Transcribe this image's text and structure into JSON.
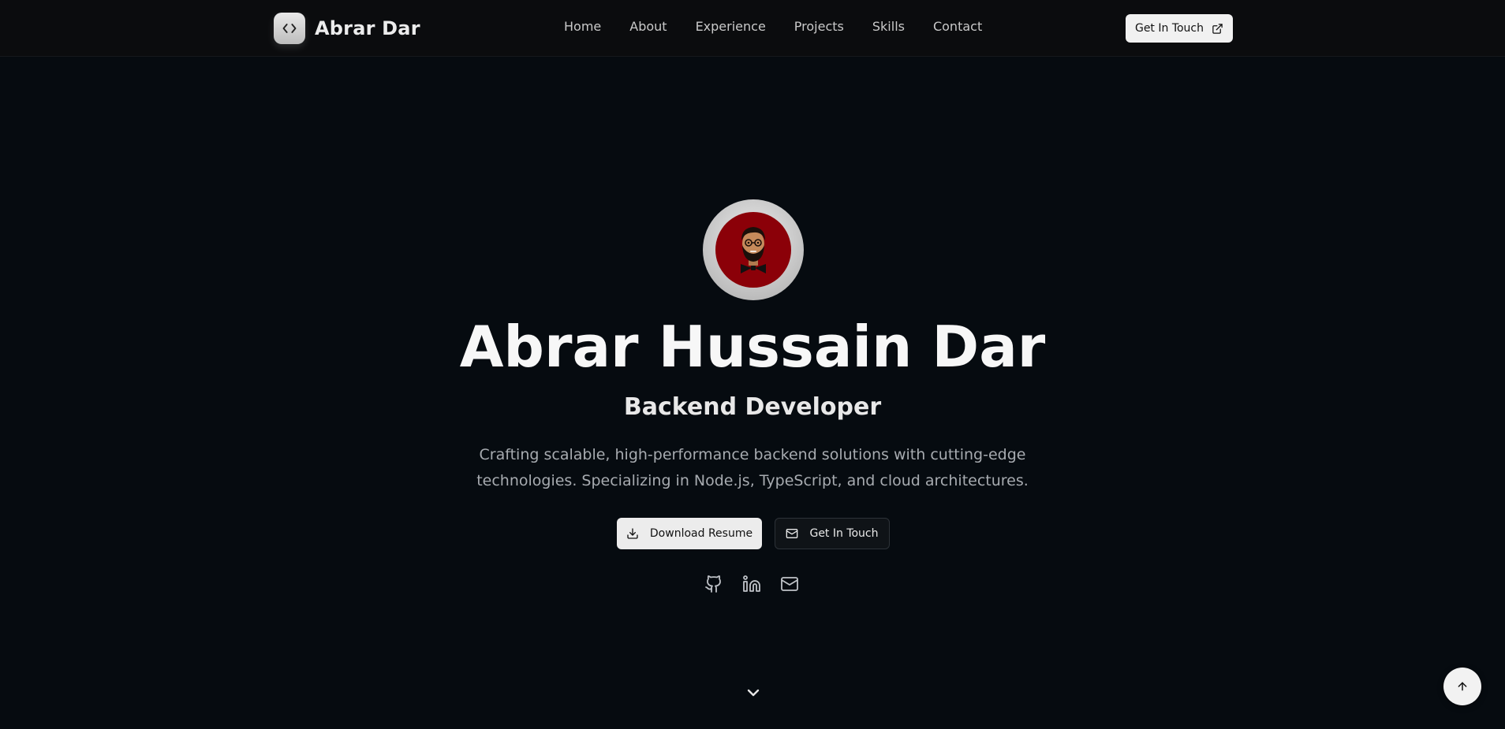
{
  "nav": {
    "brand_name": "Abrar Dar",
    "brand_icon": "code-icon",
    "links": [
      {
        "label": "Home"
      },
      {
        "label": "About"
      },
      {
        "label": "Experience"
      },
      {
        "label": "Projects"
      },
      {
        "label": "Skills"
      },
      {
        "label": "Contact"
      }
    ],
    "cta_label": "Get In Touch",
    "cta_icon": "external-link-icon"
  },
  "hero": {
    "avatar_icon": "cartoon-avatar",
    "name": "Abrar Hussain Dar",
    "role": "Backend Developer",
    "description_lines": [
      "Crafting scalable, high-performance backend solutions with cutting-edge",
      "technologies. Specializing in Node.js, TypeScript, and cloud architectures."
    ],
    "primary_button": {
      "label": "Download Resume",
      "icon": "download-icon"
    },
    "secondary_button": {
      "label": "Get In Touch",
      "icon": "mail-icon"
    },
    "socials": [
      {
        "icon": "github-icon"
      },
      {
        "icon": "linkedin-icon"
      },
      {
        "icon": "mail-icon"
      }
    ],
    "scroll_icon": "chevron-down-icon"
  },
  "back_to_top_icon": "arrow-up-icon",
  "colors": {
    "background": "#060b10",
    "navbar": "#0b0c0e",
    "avatar_bg": "#8b0008",
    "button_light": "#ececec",
    "text_muted": "#a7abb0"
  }
}
